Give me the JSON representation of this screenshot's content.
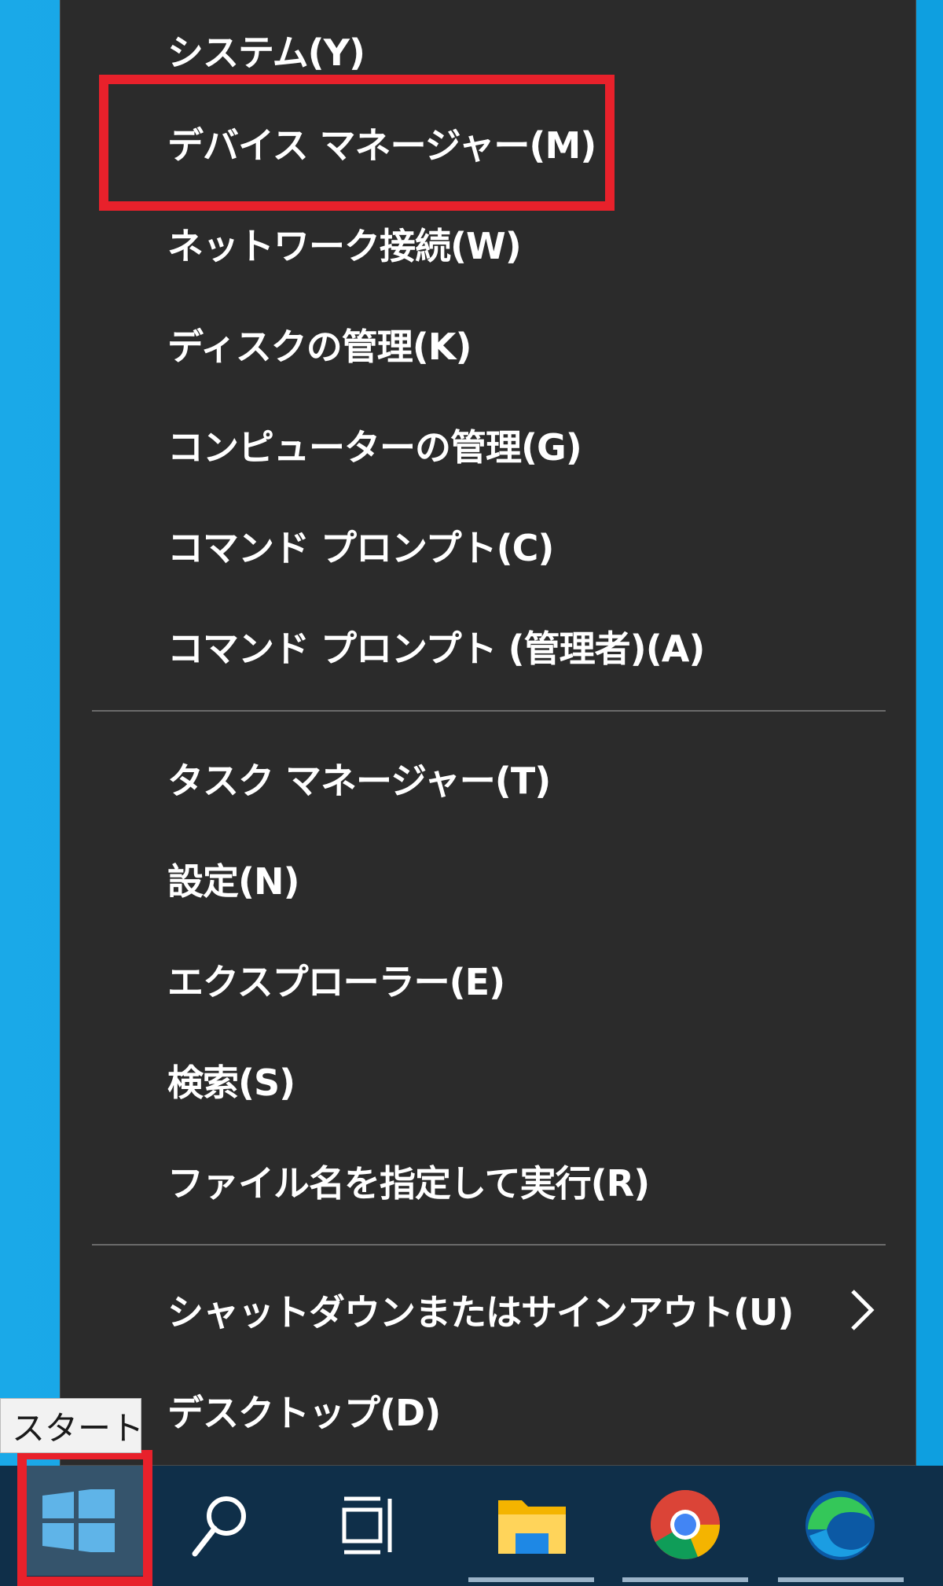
{
  "menu": {
    "items": [
      {
        "label": "システム(Y)"
      },
      {
        "label": "デバイス マネージャー(M)"
      },
      {
        "label": "ネットワーク接続(W)"
      },
      {
        "label": "ディスクの管理(K)"
      },
      {
        "label": "コンピューターの管理(G)"
      },
      {
        "label": "コマンド プロンプト(C)"
      },
      {
        "label": "コマンド プロンプト (管理者)(A)"
      },
      {
        "label": "タスク マネージャー(T)"
      },
      {
        "label": "設定(N)"
      },
      {
        "label": "エクスプローラー(E)"
      },
      {
        "label": "検索(S)"
      },
      {
        "label": "ファイル名を指定して実行(R)"
      },
      {
        "label": "シャットダウンまたはサインアウト(U)"
      },
      {
        "label": "デスクトップ(D)"
      }
    ],
    "highlighted_item": "デバイス マネージャー(M)",
    "submenu_icon": "chevron-right-icon"
  },
  "tooltip": {
    "text": "スタート"
  },
  "taskbar": {
    "icons": [
      "windows-start-icon",
      "search-icon",
      "task-view-icon",
      "file-explorer-icon",
      "chrome-icon",
      "edge-icon"
    ]
  },
  "colors": {
    "menu_bg": "#2b2b2b",
    "highlight": "#e8212b",
    "taskbar_bg": "#0f2f49",
    "desktop_bg": "#12a5e6"
  }
}
